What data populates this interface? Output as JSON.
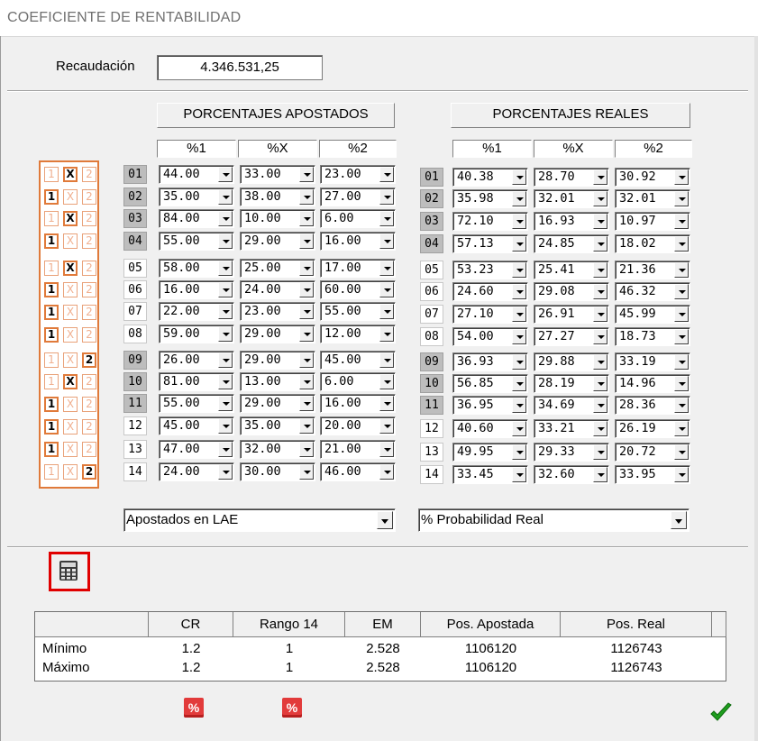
{
  "window": {
    "title": "COEFICIENTE DE RENTABILIDAD"
  },
  "recaudacion": {
    "label": "Recaudación",
    "value": "4.346.531,25"
  },
  "apostados": {
    "header": "PORCENTAJES APOSTADOS",
    "cols": [
      "%1",
      "%X",
      "%2"
    ],
    "rows": [
      [
        "44.00",
        "33.00",
        "23.00"
      ],
      [
        "35.00",
        "38.00",
        "27.00"
      ],
      [
        "84.00",
        "10.00",
        "6.00"
      ],
      [
        "55.00",
        "29.00",
        "16.00"
      ],
      [
        "58.00",
        "25.00",
        "17.00"
      ],
      [
        "16.00",
        "24.00",
        "60.00"
      ],
      [
        "22.00",
        "23.00",
        "55.00"
      ],
      [
        "59.00",
        "29.00",
        "12.00"
      ],
      [
        "26.00",
        "29.00",
        "45.00"
      ],
      [
        "81.00",
        "13.00",
        "6.00"
      ],
      [
        "55.00",
        "29.00",
        "16.00"
      ],
      [
        "45.00",
        "35.00",
        "20.00"
      ],
      [
        "47.00",
        "32.00",
        "21.00"
      ],
      [
        "24.00",
        "30.00",
        "46.00"
      ]
    ],
    "source": "Apostados en LAE"
  },
  "reales": {
    "header": "PORCENTAJES REALES",
    "cols": [
      "%1",
      "%X",
      "%2"
    ],
    "rows": [
      [
        "40.38",
        "28.70",
        "30.92"
      ],
      [
        "35.98",
        "32.01",
        "32.01"
      ],
      [
        "72.10",
        "16.93",
        "10.97"
      ],
      [
        "57.13",
        "24.85",
        "18.02"
      ],
      [
        "53.23",
        "25.41",
        "21.36"
      ],
      [
        "24.60",
        "29.08",
        "46.32"
      ],
      [
        "27.10",
        "26.91",
        "45.99"
      ],
      [
        "54.00",
        "27.27",
        "18.73"
      ],
      [
        "36.93",
        "29.88",
        "33.19"
      ],
      [
        "56.85",
        "28.19",
        "14.96"
      ],
      [
        "36.95",
        "34.69",
        "28.36"
      ],
      [
        "40.60",
        "33.21",
        "26.19"
      ],
      [
        "49.95",
        "29.33",
        "20.72"
      ],
      [
        "33.45",
        "32.60",
        "33.95"
      ]
    ],
    "source": "% Probabilidad Real"
  },
  "row_numbers": [
    "01",
    "02",
    "03",
    "04",
    "05",
    "06",
    "07",
    "08",
    "09",
    "10",
    "11",
    "12",
    "13",
    "14"
  ],
  "ticket": {
    "symbols": [
      "1",
      "X",
      "2"
    ],
    "picks": [
      "X",
      "1",
      "X",
      "1",
      "X",
      "1",
      "1",
      "1",
      "2",
      "X",
      "1",
      "1",
      "1",
      "2"
    ]
  },
  "results": {
    "headers": [
      "",
      "CR",
      "Rango 14",
      "EM",
      "Pos. Apostada",
      "Pos. Real"
    ],
    "rows": [
      [
        "Mínimo",
        "1.2",
        "1",
        "2.528",
        "1106120",
        "1126743"
      ],
      [
        "Máximo",
        "1.2",
        "1",
        "2.528",
        "1106120",
        "1126743"
      ]
    ]
  },
  "buttons": {
    "pct_label": "%"
  },
  "icons": {
    "calculator": "calculator-icon",
    "percent": "percent-icon",
    "ok": "check-icon"
  },
  "colors": {
    "ticket_border": "#e07a3a",
    "highlight": "#e00000",
    "percent_button": "#e23b3b",
    "check": "#1e9e1e"
  }
}
